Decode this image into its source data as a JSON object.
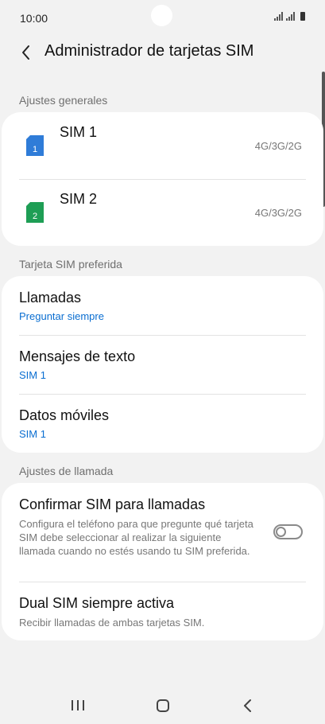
{
  "status_bar": {
    "time": "10:00"
  },
  "header": {
    "title": "Administrador de tarjetas SIM"
  },
  "general": {
    "label": "Ajustes generales",
    "sims": [
      {
        "name": "SIM 1",
        "number": "1",
        "network": "4G/3G/2G",
        "color": "#2f7cd8"
      },
      {
        "name": "SIM 2",
        "number": "2",
        "network": "4G/3G/2G",
        "color": "#1e9e55"
      }
    ]
  },
  "preferred": {
    "label": "Tarjeta SIM preferida",
    "items": [
      {
        "title": "Llamadas",
        "value": "Preguntar siempre"
      },
      {
        "title": "Mensajes de texto",
        "value": "SIM 1"
      },
      {
        "title": "Datos móviles",
        "value": "SIM 1"
      }
    ]
  },
  "call_settings": {
    "label": "Ajustes de llamada",
    "confirm": {
      "title": "Confirmar SIM para llamadas",
      "description": "Configura el teléfono para que pregunte qué tarjeta SIM debe seleccionar al realizar la siguiente llamada cuando no estés usando tu SIM preferida.",
      "enabled": false
    },
    "dual": {
      "title": "Dual SIM siempre activa",
      "description": "Recibir llamadas de ambas tarjetas SIM."
    }
  },
  "colors": {
    "accent": "#0a6ed1",
    "background": "#f2f2f2",
    "card": "#ffffff"
  },
  "icons": {
    "back": "chevron-left-icon",
    "nav_recent": "recent-apps-icon",
    "nav_home": "home-icon",
    "nav_back": "back-icon"
  }
}
